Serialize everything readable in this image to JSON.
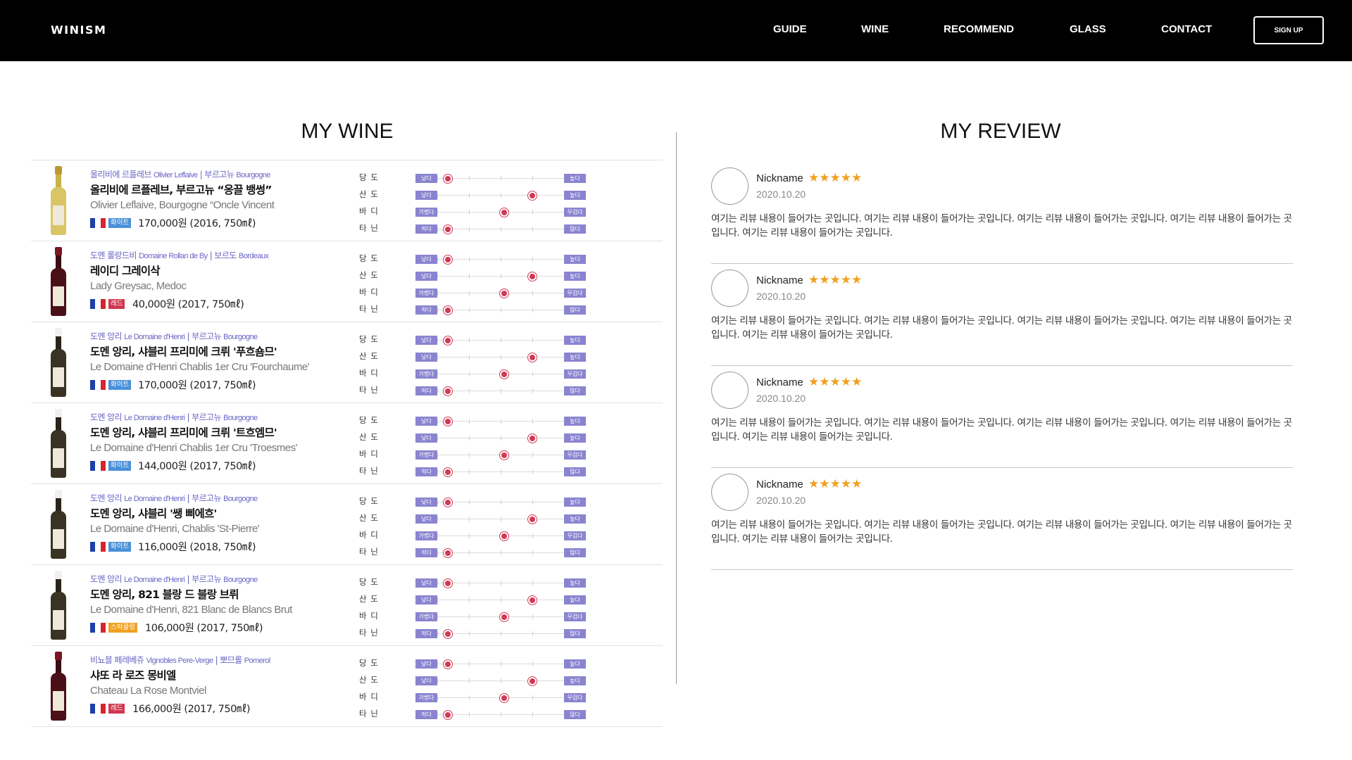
{
  "nav": {
    "logo": "WINISM",
    "links": [
      "GUIDE",
      "WINE",
      "RECOMMEND",
      "GLASS",
      "CONTACT"
    ],
    "signup": "SIGN UP"
  },
  "my_wine": {
    "title": "MY WINE",
    "attr_labels": [
      "당 도",
      "산 도",
      "바 디",
      "타 닌"
    ],
    "lo_labels": [
      "낮다",
      "낮다",
      "가볍다",
      "적다"
    ],
    "hi_labels": [
      "높다",
      "높다",
      "무겁다",
      "많다"
    ],
    "levels": [
      0,
      0.75,
      0.5,
      0
    ],
    "colors": {
      "region": "#6a64c4",
      "badge": "#8a84d0",
      "knob": "#d03a55",
      "white_wine": "#4a90d9",
      "red_wine": "#d0364e",
      "sparkling": "#f0a020"
    },
    "wines": [
      {
        "region_ko": "올리비에 르플레브",
        "region_en": "Olivier Leflaive",
        "area_ko": "부르고뉴",
        "area_en": "Bourgogne",
        "name_ko": "올리비에 르플레브, 부르고뉴 “옹끌 뱅썽”",
        "name_en": "Olivier Leflaive, Bourgogne “Oncle Vincent",
        "type": "화이트",
        "type_color": "white",
        "bottle": "white",
        "price": "170,000원 (2016, 750㎖)"
      },
      {
        "region_ko": "도멘 롤랑드비",
        "region_en": "Domaine Rollan de By",
        "area_ko": "보르도",
        "area_en": "Bordeaux",
        "name_ko": "레이디 그레이삭",
        "name_en": "Lady Greysac, Medoc",
        "type": "레드",
        "type_color": "red",
        "bottle": "red",
        "price": "40,000원 (2017, 750㎖)"
      },
      {
        "region_ko": "도멘 앙리",
        "region_en": "Le Domaine d'Henri",
        "area_ko": "부르고뉴",
        "area_en": "Bourgogne",
        "name_ko": "도멘 앙리, 샤블리 프리미에 크뤼 '푸흐숌므'",
        "name_en": "Le Domaine d'Henri Chablis 1er Cru 'Fourchaume'",
        "type": "화이트",
        "type_color": "white",
        "bottle": "dark",
        "price": "170,000원 (2017, 750㎖)"
      },
      {
        "region_ko": "도멘 앙리",
        "region_en": "Le Domaine d'Henri",
        "area_ko": "부르고뉴",
        "area_en": "Bourgogne",
        "name_ko": "도멘 앙리, 샤블리 프리미에 크뤼 '트흐엠므'",
        "name_en": "Le Domaine d'Henri Chablis 1er Cru 'Troesmes'",
        "type": "화이트",
        "type_color": "white",
        "bottle": "dark",
        "price": "144,000원 (2017, 750㎖)"
      },
      {
        "region_ko": "도멘 앙리",
        "region_en": "Le Domaine d'Henri",
        "area_ko": "부르고뉴",
        "area_en": "Bourgogne",
        "name_ko": "도멘 앙리, 샤블리 '쌩 삐에흐'",
        "name_en": "Le Domaine d'Henri, Chablis 'St-Pierre'",
        "type": "화이트",
        "type_color": "white",
        "bottle": "dark",
        "price": "116,000원 (2018, 750㎖)"
      },
      {
        "region_ko": "도멘 앙리",
        "region_en": "Le Domaine d'Henri",
        "area_ko": "부르고뉴",
        "area_en": "Bourgogne",
        "name_ko": "도멘 앙리, 821 블랑 드 블랑 브뤼",
        "name_en": "Le Domaine d'Henri, 821 Blanc de Blancs Brut",
        "type": "스파클링",
        "type_color": "sparkling",
        "bottle": "dark",
        "price": "106,000원 (2017, 750㎖)"
      },
      {
        "region_ko": "비뇨블 페레베쥬",
        "region_en": "Vignobles Pere-Verge",
        "area_ko": "뽀므롤",
        "area_en": "Pomerol",
        "name_ko": "샤또 라 로즈 몽비엘",
        "name_en": "Chateau La Rose Montviel",
        "type": "레드",
        "type_color": "red",
        "bottle": "red",
        "price": "166,000원 (2017, 750㎖)"
      }
    ]
  },
  "my_review": {
    "title": "MY REVIEW",
    "reviews": [
      {
        "nickname": "Nickname",
        "stars": "★★★★★",
        "date": "2020.10.20",
        "text": "여기는 리뷰 내용이 들어가는 곳입니다. 여기는 리뷰 내용이 들어가는 곳입니다. 여기는 리뷰 내용이 들어가는 곳입니다. 여기는 리뷰 내용이 들어가는 곳입니다. 여기는 리뷰 내용이 들어가는 곳입니다."
      },
      {
        "nickname": "Nickname",
        "stars": "★★★★★",
        "date": "2020.10.20",
        "text": "여기는 리뷰 내용이 들어가는 곳입니다. 여기는 리뷰 내용이 들어가는 곳입니다. 여기는 리뷰 내용이 들어가는 곳입니다. 여기는 리뷰 내용이 들어가는 곳입니다. 여기는 리뷰 내용이 들어가는 곳입니다."
      },
      {
        "nickname": "Nickname",
        "stars": "★★★★★",
        "date": "2020.10.20",
        "text": "여기는 리뷰 내용이 들어가는 곳입니다. 여기는 리뷰 내용이 들어가는 곳입니다. 여기는 리뷰 내용이 들어가는 곳입니다. 여기는 리뷰 내용이 들어가는 곳입니다. 여기는 리뷰 내용이 들어가는 곳입니다."
      },
      {
        "nickname": "Nickname",
        "stars": "★★★★★",
        "date": "2020.10.20",
        "text": "여기는 리뷰 내용이 들어가는 곳입니다. 여기는 리뷰 내용이 들어가는 곳입니다. 여기는 리뷰 내용이 들어가는 곳입니다. 여기는 리뷰 내용이 들어가는 곳입니다. 여기는 리뷰 내용이 들어가는 곳입니다."
      }
    ]
  }
}
